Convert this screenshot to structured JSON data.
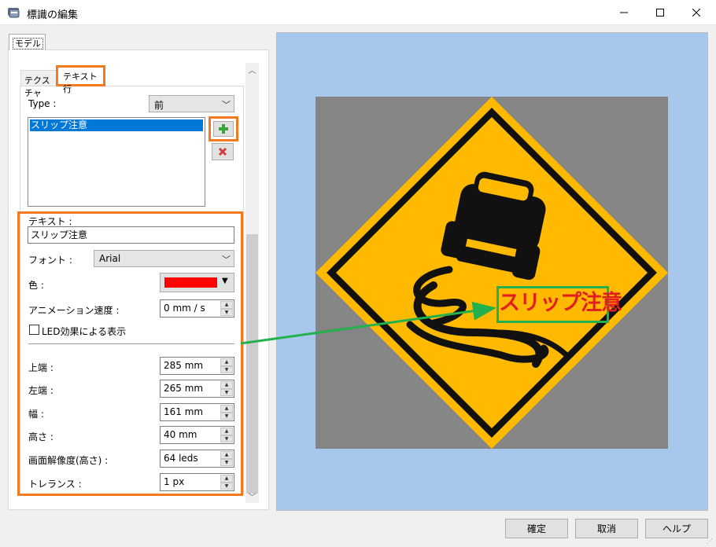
{
  "window": {
    "title": "標識の編集",
    "icon": "sign-editor-icon"
  },
  "outer_tabs": [
    {
      "label": "モデル"
    }
  ],
  "inner_tabs": [
    {
      "label": "テクスチャ"
    },
    {
      "label": "テキスト行"
    }
  ],
  "text_lines": {
    "type_label": "Type :",
    "type_value": "前",
    "items": [
      "スリップ注意"
    ],
    "add_icon": "plus-icon",
    "delete_icon": "delete-x-icon"
  },
  "properties": {
    "text_label": "テキスト :",
    "text_value": "スリップ注意",
    "font_label": "フォント :",
    "font_value": "Arial",
    "color_label": "色 :",
    "color_value": "#ff0000",
    "anim_speed_label": "アニメーション速度 :",
    "anim_speed_value": "0 mm / s",
    "led_label": "LED効果による表示",
    "led_checked": false,
    "top_label": "上端 :",
    "top_value": "285 mm",
    "left_label": "左端 :",
    "left_value": "265 mm",
    "width_label": "幅 :",
    "width_value": "161 mm",
    "height_label": "高さ :",
    "height_value": "40 mm",
    "resolution_label": "画面解像度(高さ) :",
    "resolution_value": "64 leds",
    "tolerance_label": "トレランス :",
    "tolerance_value": "1 px"
  },
  "preview": {
    "sign_text": "スリップ注意",
    "sign_text_color": "#e31e1e",
    "sign_fill_color": "#ffba00",
    "highlight_color": "#22b14c"
  },
  "accent_color": "#f37a20",
  "buttons": {
    "ok": "確定",
    "cancel": "取消",
    "help": "ヘルプ"
  }
}
